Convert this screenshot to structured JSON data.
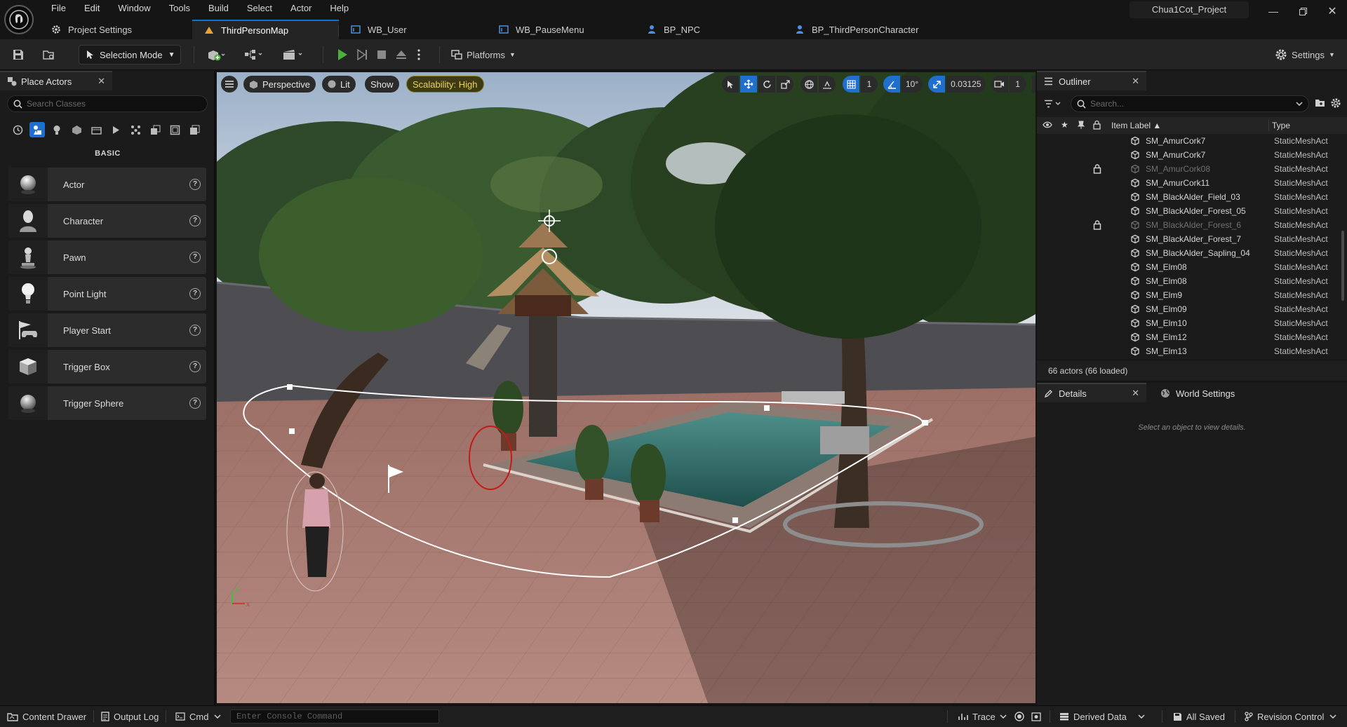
{
  "menu": [
    "File",
    "Edit",
    "Window",
    "Tools",
    "Build",
    "Select",
    "Actor",
    "Help"
  ],
  "project_name": "Chua1Cot_Project",
  "tabs": [
    {
      "label": "Project Settings",
      "icon": "gear-icon"
    },
    {
      "label": "ThirdPersonMap",
      "icon": "level-icon",
      "active": true
    },
    {
      "label": "WB_User",
      "icon": "widget-blueprint-icon"
    },
    {
      "label": "WB_PauseMenu",
      "icon": "widget-blueprint-icon"
    },
    {
      "label": "BP_NPC",
      "icon": "blueprint-icon"
    },
    {
      "label": "BP_ThirdPersonCharacter",
      "icon": "blueprint-icon"
    }
  ],
  "toolbar": {
    "mode_label": "Selection Mode",
    "platforms_label": "Platforms",
    "settings_label": "Settings"
  },
  "place_actors": {
    "title": "Place Actors",
    "search_placeholder": "Search Classes",
    "section": "BASIC",
    "items": [
      {
        "label": "Actor",
        "icon": "sphere-icon"
      },
      {
        "label": "Character",
        "icon": "character-icon"
      },
      {
        "label": "Pawn",
        "icon": "pawn-icon"
      },
      {
        "label": "Point Light",
        "icon": "bulb-icon"
      },
      {
        "label": "Player Start",
        "icon": "player-start-icon"
      },
      {
        "label": "Trigger Box",
        "icon": "cube-icon"
      },
      {
        "label": "Trigger Sphere",
        "icon": "sphere-icon"
      }
    ]
  },
  "viewport": {
    "perspective": "Perspective",
    "lit": "Lit",
    "show": "Show",
    "scalability": "Scalability: High",
    "grid_snap": "1",
    "rotation_snap": "10°",
    "scale_snap": "0.03125",
    "camera_speed": "1"
  },
  "outliner": {
    "title": "Outliner",
    "search_placeholder": "Search...",
    "col_label": "Item Label ▲",
    "col_type": "Type",
    "rows": [
      {
        "label": "SM_AmurCork7",
        "type": "StaticMeshAct",
        "locked": false
      },
      {
        "label": "SM_AmurCork7",
        "type": "StaticMeshAct",
        "locked": false
      },
      {
        "label": "SM_AmurCork08",
        "type": "StaticMeshAct",
        "locked": true
      },
      {
        "label": "SM_AmurCork11",
        "type": "StaticMeshAct",
        "locked": false
      },
      {
        "label": "SM_BlackAlder_Field_03",
        "type": "StaticMeshAct",
        "locked": false
      },
      {
        "label": "SM_BlackAlder_Forest_05",
        "type": "StaticMeshAct",
        "locked": false
      },
      {
        "label": "SM_BlackAlder_Forest_6",
        "type": "StaticMeshAct",
        "locked": true
      },
      {
        "label": "SM_BlackAlder_Forest_7",
        "type": "StaticMeshAct",
        "locked": false
      },
      {
        "label": "SM_BlackAlder_Sapling_04",
        "type": "StaticMeshAct",
        "locked": false
      },
      {
        "label": "SM_Elm08",
        "type": "StaticMeshAct",
        "locked": false
      },
      {
        "label": "SM_Elm08",
        "type": "StaticMeshAct",
        "locked": false
      },
      {
        "label": "SM_Elm9",
        "type": "StaticMeshAct",
        "locked": false
      },
      {
        "label": "SM_Elm09",
        "type": "StaticMeshAct",
        "locked": false
      },
      {
        "label": "SM_Elm10",
        "type": "StaticMeshAct",
        "locked": false
      },
      {
        "label": "SM_Elm12",
        "type": "StaticMeshAct",
        "locked": false
      },
      {
        "label": "SM_Elm13",
        "type": "StaticMeshAct",
        "locked": false
      }
    ],
    "footer": "66 actors (66 loaded)"
  },
  "details": {
    "title": "Details",
    "world_settings": "World Settings",
    "empty": "Select an object to view details."
  },
  "status": {
    "content_drawer": "Content Drawer",
    "output_log": "Output Log",
    "cmd": "Cmd",
    "console_placeholder": "Enter Console Command",
    "trace": "Trace",
    "derived_data": "Derived Data",
    "all_saved": "All Saved",
    "revision_control": "Revision Control"
  },
  "colors": {
    "accent": "#1f6fd1",
    "scalability": "#e9d35c",
    "play": "#4caf3a"
  }
}
